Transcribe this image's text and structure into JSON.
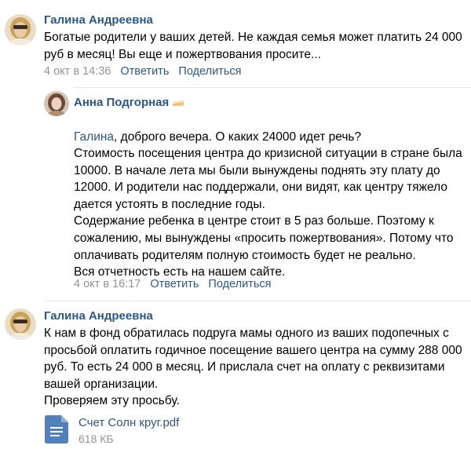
{
  "comments": [
    {
      "author": "Галина Андреевна",
      "text": "Богатые родители у ваших детей. Не каждая семья может платить 24 000\nруб в месяц! Вы еще и пожертвования просите...",
      "date": "4 окт в 14:36",
      "reply_label": "Ответить",
      "share_label": "Поделиться"
    },
    {
      "author": "Анна Подгорная",
      "author_emoji": "cake-emoji",
      "mention": "Галина",
      "text_first_line": ", доброго вечера. О каких 24000 идет речь?",
      "text": "Стоимость посещения центра до кризисной ситуации в стране была\n10000. В начале лета мы были вынуждены поднять эту плату до\n12000. И родители нас поддержали, они видят, как центру тяжело\nдается устоять в последние годы.\nСодержание ребенка в центре стоит в 5 раз больше. Поэтому к\nсожалению, мы вынуждены «просить пожертвования». Потому что\nоплачивать родителям полную стоимость будет не реально.\nВся отчетность есть на нашем сайте.",
      "date": "4 окт в 16:17",
      "reply_label": "Ответить",
      "share_label": "Поделиться"
    },
    {
      "author": "Галина Андреевна",
      "text": "К нам в фонд обратилась подруга мамы одного из ваших подопечных с\nпросьбой оплатить годичное посещение вашего центра на сумму 288 000\nруб. То есть 24 000 в месяц. И прислала счет на оплату с реквизитами\nвашей организации.\nПроверяем эту просьбу.",
      "attachment": {
        "icon": "document-icon",
        "name": "Счет Солн круг.pdf",
        "size": "618 КБ"
      }
    }
  ],
  "colors": {
    "link": "#2a5885",
    "date": "#939393",
    "divider": "#e7e8ec",
    "doc_icon": "#5181b8"
  }
}
